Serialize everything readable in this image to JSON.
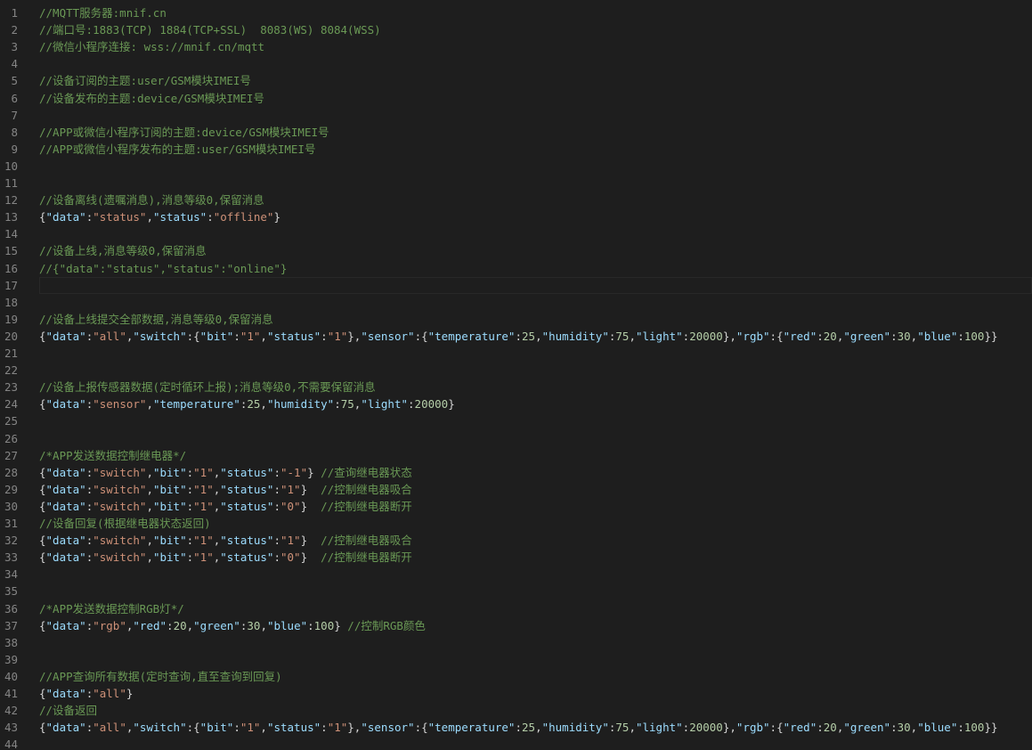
{
  "editor": {
    "colors": {
      "background": "#1e1e1e",
      "line_number": "#858585",
      "comment": "#6a9955",
      "key": "#9cdcfe",
      "string": "#ce9178",
      "number": "#b5cea8",
      "punctuation": "#d4d4d4"
    },
    "current_line": 17,
    "lines": [
      {
        "n": "1",
        "tokens": [
          [
            "c",
            "//MQTT服务器:mnif.cn"
          ]
        ]
      },
      {
        "n": "2",
        "tokens": [
          [
            "c",
            "//端口号:1883(TCP) 1884(TCP+SSL)  8083(WS) 8084(WSS)"
          ]
        ]
      },
      {
        "n": "3",
        "tokens": [
          [
            "c",
            "//微信小程序连接: wss://mnif.cn/mqtt"
          ]
        ]
      },
      {
        "n": "4",
        "tokens": []
      },
      {
        "n": "5",
        "tokens": [
          [
            "c",
            "//设备订阅的主题:user/GSM模块IMEI号"
          ]
        ]
      },
      {
        "n": "6",
        "tokens": [
          [
            "c",
            "//设备发布的主题:device/GSM模块IMEI号"
          ]
        ]
      },
      {
        "n": "7",
        "tokens": []
      },
      {
        "n": "8",
        "tokens": [
          [
            "c",
            "//APP或微信小程序订阅的主题:device/GSM模块IMEI号"
          ]
        ]
      },
      {
        "n": "9",
        "tokens": [
          [
            "c",
            "//APP或微信小程序发布的主题:user/GSM模块IMEI号"
          ]
        ]
      },
      {
        "n": "10",
        "tokens": []
      },
      {
        "n": "11",
        "tokens": []
      },
      {
        "n": "12",
        "tokens": [
          [
            "c",
            "//设备离线(遗嘱消息),消息等级0,保留消息"
          ]
        ]
      },
      {
        "n": "13",
        "tokens": [
          [
            "p",
            "{"
          ],
          [
            "k",
            "\"data\""
          ],
          [
            "p",
            ":"
          ],
          [
            "s",
            "\"status\""
          ],
          [
            "p",
            ","
          ],
          [
            "k",
            "\"status\""
          ],
          [
            "p",
            ":"
          ],
          [
            "s",
            "\"offline\""
          ],
          [
            "p",
            "}"
          ]
        ]
      },
      {
        "n": "14",
        "tokens": []
      },
      {
        "n": "15",
        "tokens": [
          [
            "c",
            "//设备上线,消息等级0,保留消息"
          ]
        ]
      },
      {
        "n": "16",
        "tokens": [
          [
            "c",
            "//{\"data\":\"status\",\"status\":\"online\"}"
          ]
        ]
      },
      {
        "n": "17",
        "tokens": []
      },
      {
        "n": "18",
        "tokens": []
      },
      {
        "n": "19",
        "tokens": [
          [
            "c",
            "//设备上线提交全部数据,消息等级0,保留消息"
          ]
        ]
      },
      {
        "n": "20",
        "tokens": [
          [
            "p",
            "{"
          ],
          [
            "k",
            "\"data\""
          ],
          [
            "p",
            ":"
          ],
          [
            "s",
            "\"all\""
          ],
          [
            "p",
            ","
          ],
          [
            "k",
            "\"switch\""
          ],
          [
            "p",
            ":{"
          ],
          [
            "k",
            "\"bit\""
          ],
          [
            "p",
            ":"
          ],
          [
            "s",
            "\"1\""
          ],
          [
            "p",
            ","
          ],
          [
            "k",
            "\"status\""
          ],
          [
            "p",
            ":"
          ],
          [
            "s",
            "\"1\""
          ],
          [
            "p",
            "},"
          ],
          [
            "k",
            "\"sensor\""
          ],
          [
            "p",
            ":{"
          ],
          [
            "k",
            "\"temperature\""
          ],
          [
            "p",
            ":"
          ],
          [
            "n",
            "25"
          ],
          [
            "p",
            ","
          ],
          [
            "k",
            "\"humidity\""
          ],
          [
            "p",
            ":"
          ],
          [
            "n",
            "75"
          ],
          [
            "p",
            ","
          ],
          [
            "k",
            "\"light\""
          ],
          [
            "p",
            ":"
          ],
          [
            "n",
            "20000"
          ],
          [
            "p",
            "},"
          ],
          [
            "k",
            "\"rgb\""
          ],
          [
            "p",
            ":{"
          ],
          [
            "k",
            "\"red\""
          ],
          [
            "p",
            ":"
          ],
          [
            "n",
            "20"
          ],
          [
            "p",
            ","
          ],
          [
            "k",
            "\"green\""
          ],
          [
            "p",
            ":"
          ],
          [
            "n",
            "30"
          ],
          [
            "p",
            ","
          ],
          [
            "k",
            "\"blue\""
          ],
          [
            "p",
            ":"
          ],
          [
            "n",
            "100"
          ],
          [
            "p",
            "}}"
          ]
        ]
      },
      {
        "n": "21",
        "tokens": []
      },
      {
        "n": "22",
        "tokens": []
      },
      {
        "n": "23",
        "tokens": [
          [
            "c",
            "//设备上报传感器数据(定时循环上报);消息等级0,不需要保留消息"
          ]
        ]
      },
      {
        "n": "24",
        "tokens": [
          [
            "p",
            "{"
          ],
          [
            "k",
            "\"data\""
          ],
          [
            "p",
            ":"
          ],
          [
            "s",
            "\"sensor\""
          ],
          [
            "p",
            ","
          ],
          [
            "k",
            "\"temperature\""
          ],
          [
            "p",
            ":"
          ],
          [
            "n",
            "25"
          ],
          [
            "p",
            ","
          ],
          [
            "k",
            "\"humidity\""
          ],
          [
            "p",
            ":"
          ],
          [
            "n",
            "75"
          ],
          [
            "p",
            ","
          ],
          [
            "k",
            "\"light\""
          ],
          [
            "p",
            ":"
          ],
          [
            "n",
            "20000"
          ],
          [
            "p",
            "}"
          ]
        ]
      },
      {
        "n": "25",
        "tokens": []
      },
      {
        "n": "26",
        "tokens": []
      },
      {
        "n": "27",
        "tokens": [
          [
            "c",
            "/*APP发送数据控制继电器*/"
          ]
        ]
      },
      {
        "n": "28",
        "tokens": [
          [
            "p",
            "{"
          ],
          [
            "k",
            "\"data\""
          ],
          [
            "p",
            ":"
          ],
          [
            "s",
            "\"switch\""
          ],
          [
            "p",
            ","
          ],
          [
            "k",
            "\"bit\""
          ],
          [
            "p",
            ":"
          ],
          [
            "s",
            "\"1\""
          ],
          [
            "p",
            ","
          ],
          [
            "k",
            "\"status\""
          ],
          [
            "p",
            ":"
          ],
          [
            "s",
            "\"-1\""
          ],
          [
            "p",
            "} "
          ],
          [
            "c",
            "//查询继电器状态"
          ]
        ]
      },
      {
        "n": "29",
        "tokens": [
          [
            "p",
            "{"
          ],
          [
            "k",
            "\"data\""
          ],
          [
            "p",
            ":"
          ],
          [
            "s",
            "\"switch\""
          ],
          [
            "p",
            ","
          ],
          [
            "k",
            "\"bit\""
          ],
          [
            "p",
            ":"
          ],
          [
            "s",
            "\"1\""
          ],
          [
            "p",
            ","
          ],
          [
            "k",
            "\"status\""
          ],
          [
            "p",
            ":"
          ],
          [
            "s",
            "\"1\""
          ],
          [
            "p",
            "}  "
          ],
          [
            "c",
            "//控制继电器吸合"
          ]
        ]
      },
      {
        "n": "30",
        "tokens": [
          [
            "p",
            "{"
          ],
          [
            "k",
            "\"data\""
          ],
          [
            "p",
            ":"
          ],
          [
            "s",
            "\"switch\""
          ],
          [
            "p",
            ","
          ],
          [
            "k",
            "\"bit\""
          ],
          [
            "p",
            ":"
          ],
          [
            "s",
            "\"1\""
          ],
          [
            "p",
            ","
          ],
          [
            "k",
            "\"status\""
          ],
          [
            "p",
            ":"
          ],
          [
            "s",
            "\"0\""
          ],
          [
            "p",
            "}  "
          ],
          [
            "c",
            "//控制继电器断开"
          ]
        ]
      },
      {
        "n": "31",
        "tokens": [
          [
            "c",
            "//设备回复(根据继电器状态返回)"
          ]
        ]
      },
      {
        "n": "32",
        "tokens": [
          [
            "p",
            "{"
          ],
          [
            "k",
            "\"data\""
          ],
          [
            "p",
            ":"
          ],
          [
            "s",
            "\"switch\""
          ],
          [
            "p",
            ","
          ],
          [
            "k",
            "\"bit\""
          ],
          [
            "p",
            ":"
          ],
          [
            "s",
            "\"1\""
          ],
          [
            "p",
            ","
          ],
          [
            "k",
            "\"status\""
          ],
          [
            "p",
            ":"
          ],
          [
            "s",
            "\"1\""
          ],
          [
            "p",
            "}  "
          ],
          [
            "c",
            "//控制继电器吸合"
          ]
        ]
      },
      {
        "n": "33",
        "tokens": [
          [
            "p",
            "{"
          ],
          [
            "k",
            "\"data\""
          ],
          [
            "p",
            ":"
          ],
          [
            "s",
            "\"switch\""
          ],
          [
            "p",
            ","
          ],
          [
            "k",
            "\"bit\""
          ],
          [
            "p",
            ":"
          ],
          [
            "s",
            "\"1\""
          ],
          [
            "p",
            ","
          ],
          [
            "k",
            "\"status\""
          ],
          [
            "p",
            ":"
          ],
          [
            "s",
            "\"0\""
          ],
          [
            "p",
            "}  "
          ],
          [
            "c",
            "//控制继电器断开"
          ]
        ]
      },
      {
        "n": "34",
        "tokens": []
      },
      {
        "n": "35",
        "tokens": []
      },
      {
        "n": "36",
        "tokens": [
          [
            "c",
            "/*APP发送数据控制RGB灯*/"
          ]
        ]
      },
      {
        "n": "37",
        "tokens": [
          [
            "p",
            "{"
          ],
          [
            "k",
            "\"data\""
          ],
          [
            "p",
            ":"
          ],
          [
            "s",
            "\"rgb\""
          ],
          [
            "p",
            ","
          ],
          [
            "k",
            "\"red\""
          ],
          [
            "p",
            ":"
          ],
          [
            "n",
            "20"
          ],
          [
            "p",
            ","
          ],
          [
            "k",
            "\"green\""
          ],
          [
            "p",
            ":"
          ],
          [
            "n",
            "30"
          ],
          [
            "p",
            ","
          ],
          [
            "k",
            "\"blue\""
          ],
          [
            "p",
            ":"
          ],
          [
            "n",
            "100"
          ],
          [
            "p",
            "} "
          ],
          [
            "c",
            "//控制RGB颜色"
          ]
        ]
      },
      {
        "n": "38",
        "tokens": []
      },
      {
        "n": "39",
        "tokens": []
      },
      {
        "n": "40",
        "tokens": [
          [
            "c",
            "//APP查询所有数据(定时查询,直至查询到回复)"
          ]
        ]
      },
      {
        "n": "41",
        "tokens": [
          [
            "p",
            "{"
          ],
          [
            "k",
            "\"data\""
          ],
          [
            "p",
            ":"
          ],
          [
            "s",
            "\"all\""
          ],
          [
            "p",
            "}"
          ]
        ]
      },
      {
        "n": "42",
        "tokens": [
          [
            "c",
            "//设备返回"
          ]
        ]
      },
      {
        "n": "43",
        "tokens": [
          [
            "p",
            "{"
          ],
          [
            "k",
            "\"data\""
          ],
          [
            "p",
            ":"
          ],
          [
            "s",
            "\"all\""
          ],
          [
            "p",
            ","
          ],
          [
            "k",
            "\"switch\""
          ],
          [
            "p",
            ":{"
          ],
          [
            "k",
            "\"bit\""
          ],
          [
            "p",
            ":"
          ],
          [
            "s",
            "\"1\""
          ],
          [
            "p",
            ","
          ],
          [
            "k",
            "\"status\""
          ],
          [
            "p",
            ":"
          ],
          [
            "s",
            "\"1\""
          ],
          [
            "p",
            "},"
          ],
          [
            "k",
            "\"sensor\""
          ],
          [
            "p",
            ":{"
          ],
          [
            "k",
            "\"temperature\""
          ],
          [
            "p",
            ":"
          ],
          [
            "n",
            "25"
          ],
          [
            "p",
            ","
          ],
          [
            "k",
            "\"humidity\""
          ],
          [
            "p",
            ":"
          ],
          [
            "n",
            "75"
          ],
          [
            "p",
            ","
          ],
          [
            "k",
            "\"light\""
          ],
          [
            "p",
            ":"
          ],
          [
            "n",
            "20000"
          ],
          [
            "p",
            "},"
          ],
          [
            "k",
            "\"rgb\""
          ],
          [
            "p",
            ":{"
          ],
          [
            "k",
            "\"red\""
          ],
          [
            "p",
            ":"
          ],
          [
            "n",
            "20"
          ],
          [
            "p",
            ","
          ],
          [
            "k",
            "\"green\""
          ],
          [
            "p",
            ":"
          ],
          [
            "n",
            "30"
          ],
          [
            "p",
            ","
          ],
          [
            "k",
            "\"blue\""
          ],
          [
            "p",
            ":"
          ],
          [
            "n",
            "100"
          ],
          [
            "p",
            "}}"
          ]
        ]
      },
      {
        "n": "44",
        "tokens": []
      }
    ]
  }
}
